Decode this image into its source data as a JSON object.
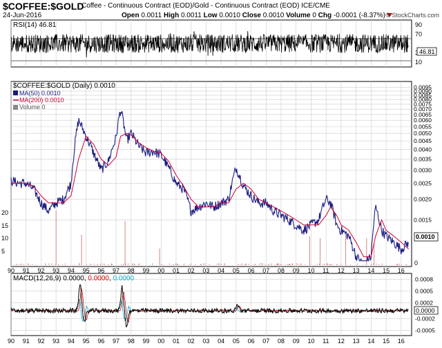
{
  "header": {
    "symbol": "$COFFEE:$GOLD",
    "description": "Coffee - Continuous Contract (EOD)/Gold - Continuous Contract (EOD) ICE/CME",
    "date": "24-Jun-2016",
    "open_label": "Open",
    "open": "0.0011",
    "high_label": "High",
    "high": "0.0011",
    "low_label": "Low",
    "low": "0.0010",
    "close_label": "Close",
    "close": "0.0010",
    "volume_label": "Volume",
    "volume": "0",
    "chg_label": "Chg",
    "chg": "-0.0001 (-8.37%)",
    "watermark": "© StockCharts.com"
  },
  "colors": {
    "price": "#1a1a80",
    "ma50": "#1a1a80",
    "ma200": "#cc0033",
    "macd": "#000000",
    "signal": "#cc0000",
    "histogram": "#00aacc",
    "volume": "#cc6666",
    "grid": "#cccccc"
  },
  "chart_data": [
    {
      "type": "line",
      "title": "RSI(14) 46.81",
      "series": [
        {
          "name": "RSI(14)",
          "last": 46.81
        }
      ],
      "y_ticks": [
        "90",
        "70",
        "30",
        "10"
      ],
      "last_label": "46.81",
      "ylim": [
        0,
        100
      ],
      "bands": [
        30,
        70
      ]
    },
    {
      "type": "line",
      "title": "$COFFEE:$GOLD (Daily) 0.0010",
      "legend": [
        "MA(50) 0.0010",
        "MA(200) 0.0010",
        "Volume 0"
      ],
      "legend_placement": "top-left",
      "x_labels": [
        "90",
        "91",
        "92",
        "93",
        "94",
        "95",
        "96",
        "97",
        "98",
        "99",
        "00",
        "01",
        "02",
        "03",
        "04",
        "05",
        "06",
        "07",
        "08",
        "09",
        "10",
        "11",
        "12",
        "13",
        "14",
        "15",
        "16"
      ],
      "y_ticks": [
        "0.0095",
        "0.0090",
        "0.0085",
        "0.0080",
        "0.0075",
        "0.0070",
        "0.0065",
        "0.0060",
        "0.0055",
        "0.0050",
        "0.0045",
        "0.0040",
        "0.0035",
        "0.0030",
        "0.0025",
        "0.0020",
        "0.0015"
      ],
      "y_tick_values": [
        0.0095,
        0.009,
        0.0085,
        0.008,
        0.0075,
        0.007,
        0.0065,
        0.006,
        0.0055,
        0.005,
        0.0045,
        0.004,
        0.0035,
        0.003,
        0.0025,
        0.002,
        0.0015
      ],
      "last_label": "0.0010",
      "volume_ticks": [
        "20",
        "15",
        "10",
        "5"
      ],
      "volume_zero": "0",
      "x": [
        1990.0,
        1990.5,
        1991.0,
        1991.5,
        1992.0,
        1992.5,
        1993.0,
        1993.5,
        1994.0,
        1994.5,
        1995.0,
        1995.5,
        1996.0,
        1996.5,
        1997.0,
        1997.3,
        1997.7,
        1998.0,
        1998.5,
        1999.0,
        1999.5,
        2000.0,
        2000.5,
        2001.0,
        2001.5,
        2002.0,
        2002.5,
        2003.0,
        2003.5,
        2004.0,
        2004.5,
        2005.0,
        2005.5,
        2006.0,
        2006.5,
        2007.0,
        2007.5,
        2008.0,
        2008.5,
        2009.0,
        2009.5,
        2010.0,
        2010.5,
        2011.0,
        2011.3,
        2011.7,
        2012.0,
        2012.5,
        2013.0,
        2013.5,
        2014.0,
        2014.3,
        2014.7,
        2015.0,
        2015.5,
        2016.0,
        2016.5
      ],
      "series": [
        {
          "name": "$COFFEE:$GOLD",
          "values": [
            0.0026,
            0.0025,
            0.0025,
            0.0023,
            0.0019,
            0.0017,
            0.0019,
            0.002,
            0.0025,
            0.006,
            0.0048,
            0.0038,
            0.003,
            0.0034,
            0.0047,
            0.007,
            0.0045,
            0.005,
            0.0042,
            0.0038,
            0.0039,
            0.0037,
            0.0031,
            0.0025,
            0.0023,
            0.0017,
            0.0018,
            0.0019,
            0.0018,
            0.0019,
            0.002,
            0.0031,
            0.0024,
            0.0021,
            0.0019,
            0.0019,
            0.0017,
            0.0016,
            0.0015,
            0.0014,
            0.0013,
            0.0014,
            0.0015,
            0.002,
            0.0019,
            0.0014,
            0.0013,
            0.0012,
            0.0009,
            0.0008,
            0.0009,
            0.0018,
            0.0013,
            0.0012,
            0.0011,
            0.001,
            0.0011
          ]
        },
        {
          "name": "MA(200)",
          "values": [
            0.0025,
            0.0025,
            0.0025,
            0.0024,
            0.0021,
            0.0019,
            0.0019,
            0.0019,
            0.0021,
            0.0035,
            0.0048,
            0.0043,
            0.0035,
            0.0032,
            0.0036,
            0.0048,
            0.005,
            0.0049,
            0.0044,
            0.0041,
            0.0039,
            0.0038,
            0.0034,
            0.0028,
            0.0024,
            0.002,
            0.0018,
            0.0018,
            0.0018,
            0.0019,
            0.0019,
            0.0023,
            0.0025,
            0.0023,
            0.002,
            0.0019,
            0.0018,
            0.0017,
            0.0016,
            0.0015,
            0.0014,
            0.0014,
            0.0014,
            0.0016,
            0.0018,
            0.0016,
            0.0014,
            0.0013,
            0.0011,
            0.0009,
            0.0009,
            0.0012,
            0.0015,
            0.0013,
            0.0012,
            0.0011,
            0.001
          ]
        }
      ]
    },
    {
      "type": "line",
      "title": "MACD(12,26,9) 0.0000, 0.0000, 0.0000",
      "macd_label": "MACD(12,26,9)",
      "macd_value": "0.0000",
      "signal_value": "0.0000",
      "hist_value": "0.0000",
      "y_ticks": [
        "0.0008",
        "0.0005",
        "0.0002",
        "0.0000",
        "-0.0002",
        "-0.0005"
      ],
      "y_tick_values": [
        0.0008,
        0.0005,
        0.0002,
        0.0,
        -0.0002,
        -0.0005
      ],
      "last_label": "0.0000",
      "ylim": [
        -0.0006,
        0.0009
      ],
      "x_labels": [
        "90",
        "91",
        "92",
        "93",
        "94",
        "95",
        "96",
        "97",
        "98",
        "99",
        "00",
        "01",
        "02",
        "03",
        "04",
        "05",
        "06",
        "07",
        "08",
        "09",
        "10",
        "11",
        "12",
        "13",
        "14",
        "15",
        "16"
      ]
    }
  ]
}
